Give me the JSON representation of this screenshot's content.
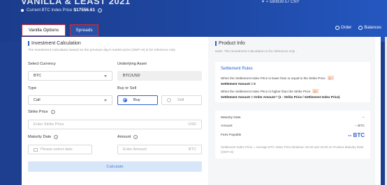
{
  "header": {
    "title": "VANILLA & LEAST 2021",
    "index_label": "Current BTC Index Price",
    "index_price": "$17556.61",
    "cny_value": "≈ 580839.57 CNY"
  },
  "tabs": [
    {
      "label": "Vanilla Options"
    },
    {
      "label": "Spreads"
    }
  ],
  "top_links": {
    "order": "Order",
    "balances": "Balances"
  },
  "calculation": {
    "title": "Investment Calculation",
    "subtitle": "The Investment Calculation based on the previous day's market price (GMT+8) is for reference only .",
    "currency_label": "Select Currency",
    "currency_value": "BTC",
    "asset_label": "Underlying Asset",
    "asset_value": "BTC/USD",
    "type_label": "Type",
    "type_value": "Call",
    "buysell_label": "Buy or Sell",
    "buy_label": "Buy",
    "sell_label": "Sell",
    "strike_label": "Strike Price",
    "strike_placeholder": "Enter Strike Price",
    "strike_unit": "USD",
    "maturity_label": "Maturity Date",
    "maturity_placeholder": "Please select date",
    "amount_label": "Amount",
    "amount_placeholder": "Enter Amount",
    "amount_unit": "BTC",
    "calculate_label": "Calculate"
  },
  "product_info": {
    "title": "Product Info",
    "note": "Note: The Investment Calculation is for reference only .",
    "rules_title": "Settlement Rules",
    "rule1_text": "When the Settlement Index Price is lower than or equal to the Strike Price",
    "rule1_result": "Settlement Amount = 0",
    "rule2_text": "When the Settlement Index Price is higher than the Strike Price",
    "rule2_result": "Settlement Amount = Order Amount * (1 - Strike Price / Settlement Index Price)",
    "tag_text": "$--",
    "maturity_label": "Maturity Date",
    "maturity_value": "--",
    "amount_label": "Amount",
    "amount_value": "-- BTC",
    "fees_label": "Fees Payable",
    "fees_value": "-- BTC",
    "footnote": "Settlement Index Price = Average BTC Index Price Between 15:30 and 16:00 on Product Maturity Date (GMT+8)"
  }
}
